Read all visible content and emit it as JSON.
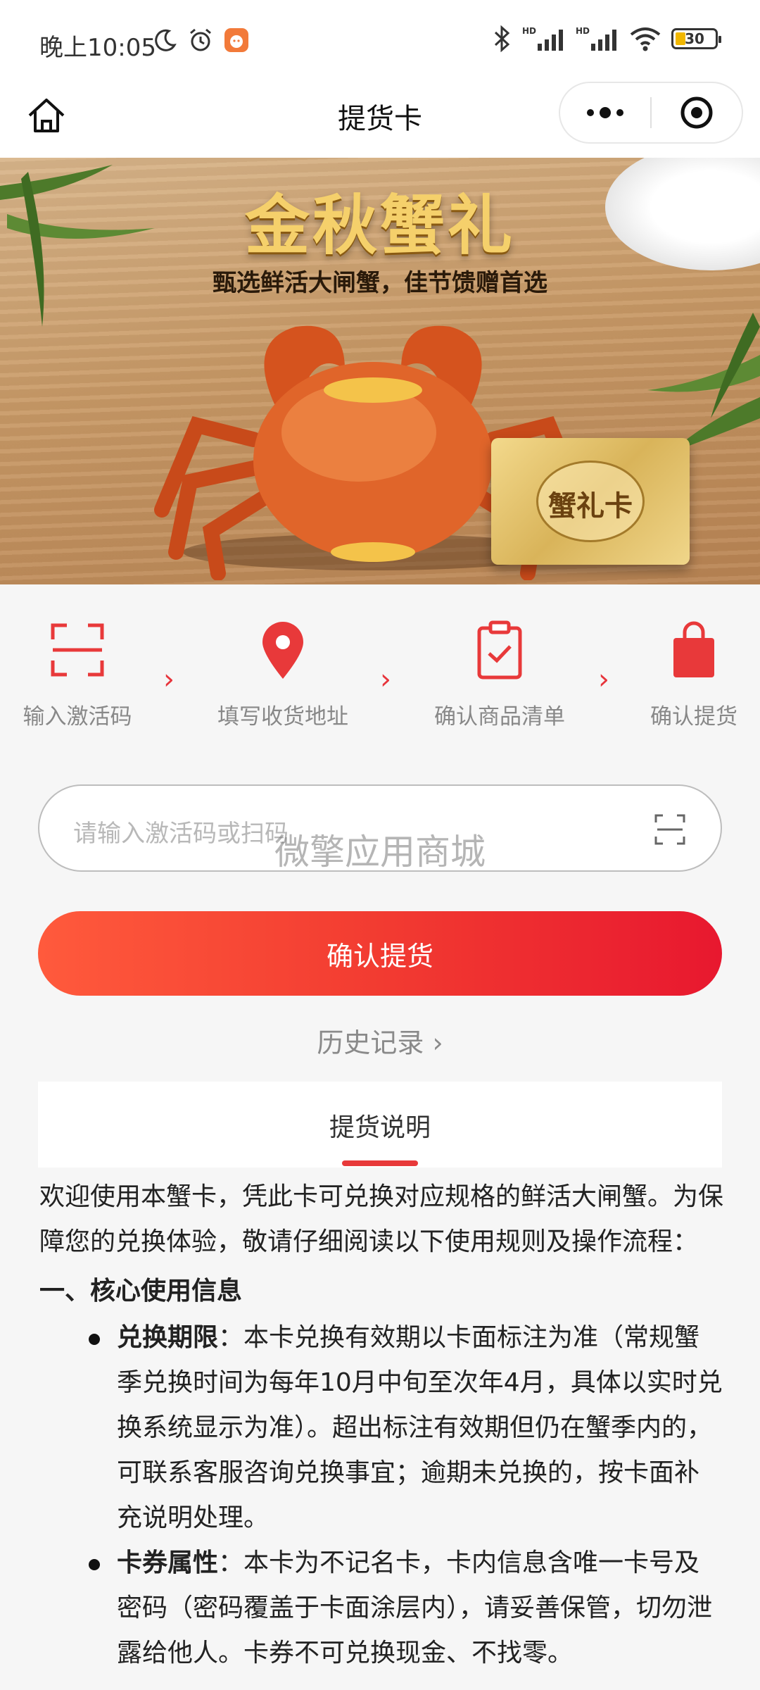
{
  "status_bar": {
    "time": "晚上10:05",
    "battery": "30"
  },
  "nav": {
    "title": "提货卡"
  },
  "banner": {
    "title": "金秋蟹礼",
    "subtitle": "甄选鲜活大闸蟹，佳节馈赠首选",
    "card_text": "蟹礼卡"
  },
  "steps": [
    {
      "label": "输入激活码",
      "icon": "scan-icon"
    },
    {
      "label": "填写收货地址",
      "icon": "location-pin-icon"
    },
    {
      "label": "确认商品清单",
      "icon": "clipboard-check-icon"
    },
    {
      "label": "确认提货",
      "icon": "shopping-bag-icon"
    }
  ],
  "code_input": {
    "placeholder": "请输入激活码或扫码",
    "value": ""
  },
  "watermark": "微擎应用商城",
  "confirm_button": "确认提货",
  "history_link": "历史记录",
  "tab": {
    "label": "提货说明"
  },
  "content": {
    "intro": "欢迎使用本蟹卡，凭此卡可兑换对应规格的鲜活大闸蟹。为保障您的兑换体验，敬请仔细阅读以下使用规则及操作流程：",
    "section1_title": "一、核心使用信息",
    "items": [
      {
        "title": "兑换期限",
        "text": "：本卡兑换有效期以卡面标注为准（常规蟹季兑换时间为每年10月中旬至次年4月，具体以实时兑换系统显示为准）。超出标注有效期但仍在蟹季内的，可联系客服咨询兑换事宜；逾期未兑换的，按卡面补充说明处理。"
      },
      {
        "title": "卡券属性",
        "text": "：本卡为不记名卡，卡内信息含唯一卡号及密码（密码覆盖于卡面涂层内），请妥善保管，切勿泄露给他人。卡券不可兑换现金、不找零。"
      }
    ]
  },
  "colors": {
    "accent": "#e8393a",
    "button_start": "#ff5a3c",
    "button_end": "#e8182f"
  }
}
